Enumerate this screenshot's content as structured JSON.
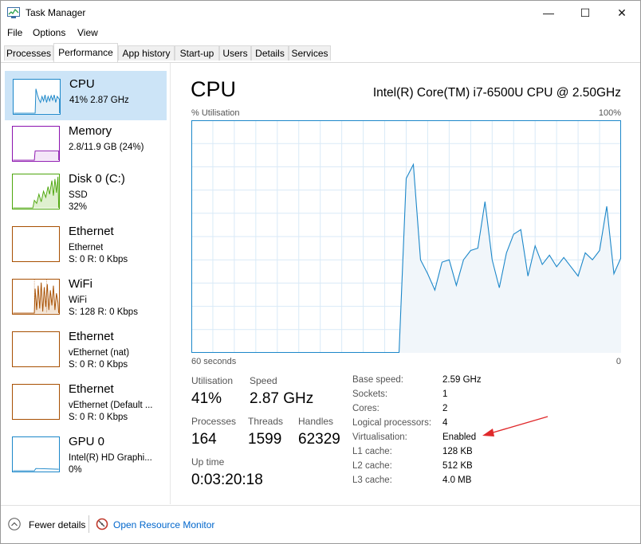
{
  "window": {
    "title": "Task Manager",
    "minimize": "—",
    "maximize": "☐",
    "close": "✕"
  },
  "menu": [
    "File",
    "Options",
    "View"
  ],
  "tabs": [
    "Processes",
    "Performance",
    "App history",
    "Start-up",
    "Users",
    "Details",
    "Services"
  ],
  "active_tab": "Performance",
  "sidebar": [
    {
      "name": "CPU",
      "line1": "41%  2.87 GHz",
      "line2": ""
    },
    {
      "name": "Memory",
      "line1": "2.8/11.9 GB (24%)",
      "line2": ""
    },
    {
      "name": "Disk 0 (C:)",
      "line1": "SSD",
      "line2": "32%"
    },
    {
      "name": "Ethernet",
      "line1": "Ethernet",
      "line2": "S: 0  R: 0 Kbps"
    },
    {
      "name": "WiFi",
      "line1": "WiFi",
      "line2": "S: 128  R: 0 Kbps"
    },
    {
      "name": "Ethernet",
      "line1": "vEthernet (nat)",
      "line2": "S: 0  R: 0 Kbps"
    },
    {
      "name": "Ethernet",
      "line1": "vEthernet (Default ...",
      "line2": "S: 0  R: 0 Kbps"
    },
    {
      "name": "GPU 0",
      "line1": "Intel(R) HD Graphi...",
      "line2": "0%"
    }
  ],
  "colors": {
    "cpu": "#1c87c9",
    "memory": "#8b12ae",
    "disk": "#4da60c",
    "network": "#a74f01",
    "accent_selected": "#cce4f7",
    "link": "#0066cc",
    "arrow": "#e0292b"
  },
  "main": {
    "title": "CPU",
    "model": "Intel(R) Core(TM) i7-6500U CPU @ 2.50GHz",
    "y_label": "% Utilisation",
    "y_max_label": "100%",
    "x_left_label": "60 seconds",
    "x_right_label": "0",
    "stats": {
      "utilisation_label": "Utilisation",
      "utilisation": "41%",
      "speed_label": "Speed",
      "speed": "2.87 GHz",
      "processes_label": "Processes",
      "processes": "164",
      "threads_label": "Threads",
      "threads": "1599",
      "handles_label": "Handles",
      "handles": "62329",
      "uptime_label": "Up time",
      "uptime": "0:03:20:18"
    },
    "details": [
      {
        "label": "Base speed:",
        "value": "2.59 GHz"
      },
      {
        "label": "Sockets:",
        "value": "1"
      },
      {
        "label": "Cores:",
        "value": "2"
      },
      {
        "label": "Logical processors:",
        "value": "4"
      },
      {
        "label": "Virtualisation:",
        "value": "Enabled"
      },
      {
        "label": "L1 cache:",
        "value": "128 KB"
      },
      {
        "label": "L2 cache:",
        "value": "512 KB"
      },
      {
        "label": "L3 cache:",
        "value": "4.0 MB"
      }
    ]
  },
  "chart_data": {
    "type": "area",
    "x": [
      60,
      59,
      58,
      57,
      56,
      55,
      54,
      53,
      52,
      51,
      50,
      49,
      48,
      47,
      46,
      45,
      44,
      43,
      42,
      41,
      40,
      39,
      38,
      37,
      36,
      35,
      34,
      33,
      32,
      31,
      30,
      29,
      28,
      27,
      26,
      25,
      24,
      23,
      22,
      21,
      20,
      19,
      18,
      17,
      16,
      15,
      14,
      13,
      12,
      11,
      10,
      9,
      8,
      7,
      6,
      5,
      4,
      3,
      2,
      1,
      0
    ],
    "y": [
      0,
      0,
      0,
      0,
      0,
      0,
      0,
      0,
      0,
      0,
      0,
      0,
      0,
      0,
      0,
      0,
      0,
      0,
      0,
      0,
      0,
      0,
      0,
      0,
      0,
      0,
      0,
      0,
      0,
      0,
      75,
      81,
      40,
      34,
      27,
      39,
      40,
      29,
      40,
      44,
      45,
      65,
      40,
      28,
      43,
      51,
      53,
      33,
      46,
      38,
      42,
      37,
      41,
      37,
      33,
      43,
      40,
      44,
      63,
      34,
      41
    ],
    "xlabel": "60 seconds",
    "ylabel": "% Utilisation",
    "ylim": [
      0,
      100
    ],
    "grid": true
  },
  "footer": {
    "fewer_details": "Fewer details",
    "resource_monitor": "Open Resource Monitor"
  }
}
